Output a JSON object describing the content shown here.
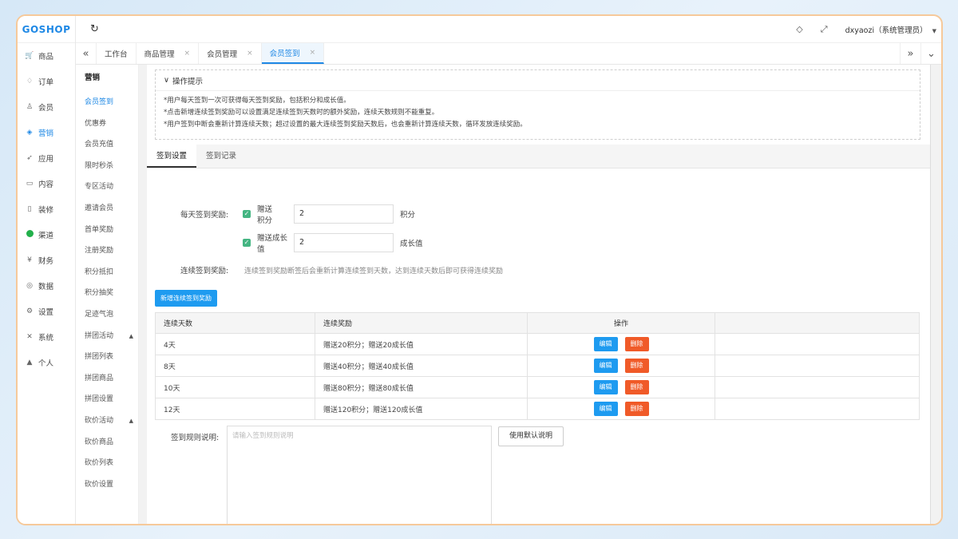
{
  "brand": "GOSHOP",
  "nav": [
    {
      "label": "商品",
      "icon": "cart-icon",
      "glyph": "🛒"
    },
    {
      "label": "订单",
      "icon": "bell-icon",
      "glyph": "♢"
    },
    {
      "label": "会员",
      "icon": "user-icon",
      "glyph": "♙"
    },
    {
      "label": "营销",
      "icon": "marketing-icon",
      "glyph": "◈"
    },
    {
      "label": "应用",
      "icon": "send-icon",
      "glyph": "➶"
    },
    {
      "label": "内容",
      "icon": "book-icon",
      "glyph": "▭"
    },
    {
      "label": "装修",
      "icon": "phone-icon",
      "glyph": "▯"
    },
    {
      "label": "渠道",
      "icon": "wechat-icon",
      "glyph": ""
    },
    {
      "label": "财务",
      "icon": "yen-icon",
      "glyph": "¥"
    },
    {
      "label": "数据",
      "icon": "globe-icon",
      "glyph": "◎"
    },
    {
      "label": "设置",
      "icon": "gear-icon",
      "glyph": "⚙"
    },
    {
      "label": "系统",
      "icon": "tools-icon",
      "glyph": "✕"
    },
    {
      "label": "个人",
      "icon": "person-icon",
      "glyph": "▲"
    }
  ],
  "topbar": {
    "refresh_glyph": "↻",
    "tag_glyph": "◇",
    "fullscreen_glyph": "⤢",
    "user": "dxyaozi（系统管理员）",
    "dropdown_glyph": "▼"
  },
  "tabs": {
    "left_glyph": "«",
    "right_glyph": "»",
    "down_glyph": "⌄",
    "items": [
      {
        "label": "工作台",
        "closable": false
      },
      {
        "label": "商品管理",
        "close": "×"
      },
      {
        "label": "会员管理",
        "close": "×"
      },
      {
        "label": "会员签到",
        "close": "×"
      }
    ]
  },
  "subnav": {
    "title": "营销",
    "items": [
      "会员签到",
      "优惠券",
      "会员充值",
      "限时秒杀",
      "专区活动",
      "邀请会员",
      "首单奖励",
      "注册奖励",
      "积分抵扣",
      "积分抽奖",
      "足迹气泡",
      "拼团活动",
      "拼团列表",
      "拼团商品",
      "拼团设置",
      "砍价活动",
      "砍价商品",
      "砍价列表",
      "砍价设置"
    ],
    "caret": "▲"
  },
  "tips": {
    "title": "操作提示",
    "toggle_glyph": "∨",
    "lines": [
      "*用户每天签到一次可获得每天签到奖励，包括积分和成长值。",
      "*点击新增连续签到奖励可以设置满足连续签到天数时的额外奖励，连续天数规则不能重复。",
      "*用户签到中断会重新计算连续天数；超过设置的最大连续签到奖励天数后，也会重新计算连续天数，循环发放连续奖励。"
    ]
  },
  "settabs": [
    "签到设置",
    "签到记录"
  ],
  "form": {
    "daily_label": "每天签到奖励:",
    "points_check_label": "赠送积分",
    "points_value": "2",
    "points_unit": "积分",
    "growth_check_label": "赠送成长值",
    "growth_value": "2",
    "growth_unit": "成长值",
    "check_glyph": "✓",
    "streak_label": "连续签到奖励:",
    "streak_hint": "连续签到奖励断签后会重新计算连续签到天数，达到连续天数后即可获得连续奖励",
    "add_button": "新增连续签到奖励"
  },
  "table": {
    "headers": [
      "连续天数",
      "连续奖励",
      "操作"
    ],
    "edit_label": "编辑",
    "delete_label": "删除",
    "rows": [
      {
        "days": "4天",
        "reward": "赠送20积分；赠送20成长值"
      },
      {
        "days": "8天",
        "reward": "赠送40积分；赠送40成长值"
      },
      {
        "days": "10天",
        "reward": "赠送80积分；赠送80成长值"
      },
      {
        "days": "12天",
        "reward": "赠送120积分；赠送120成长值"
      }
    ]
  },
  "rules": {
    "label": "签到规则说明:",
    "placeholder": "请输入签到规则说明",
    "default_button": "使用默认说明"
  }
}
